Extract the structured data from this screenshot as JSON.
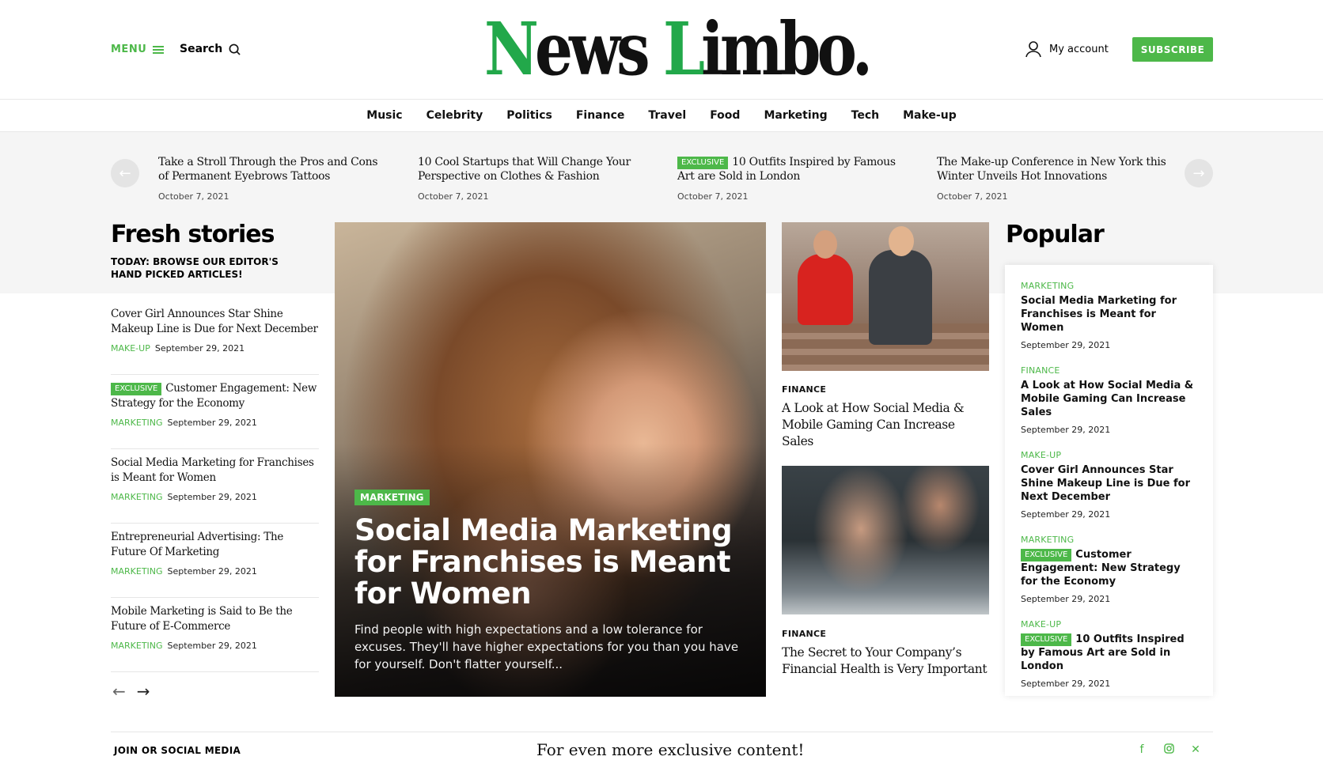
{
  "header": {
    "menu_label": "MENU",
    "search_label": "Search",
    "logo_part1": "News ",
    "logo_part2": "Limbo",
    "logo_part3": ".",
    "account_label": "My account",
    "subscribe_label": "SUBSCRIBE"
  },
  "nav": [
    "Music",
    "Celebrity",
    "Politics",
    "Finance",
    "Travel",
    "Food",
    "Marketing",
    "Tech",
    "Make-up"
  ],
  "ticker": [
    {
      "badge": "",
      "title": "Take a Stroll Through the Pros and Cons of Permanent Eyebrows Tattoos",
      "date": "October 7, 2021"
    },
    {
      "badge": "",
      "title": "10 Cool Startups that Will Change Your Perspective on Clothes & Fashion",
      "date": "October 7, 2021"
    },
    {
      "badge": "EXCLUSIVE",
      "title": "10 Outfits Inspired by Famous Art are Sold in London",
      "date": "October 7, 2021"
    },
    {
      "badge": "",
      "title": "The Make-up Conference in New York this Winter Unveils Hot Innovations",
      "date": "October 7, 2021"
    }
  ],
  "fresh": {
    "title": "Fresh stories",
    "subtitle": "TODAY: BROWSE OUR EDITOR'S HAND PICKED ARTICLES!",
    "items": [
      {
        "badge": "",
        "title": "Cover Girl Announces Star Shine Makeup Line is Due for Next December",
        "category": "MAKE-UP",
        "date": "September 29, 2021"
      },
      {
        "badge": "EXCLUSIVE",
        "title": "Customer Engagement: New Strategy for the Economy",
        "category": "MARKETING",
        "date": "September 29, 2021"
      },
      {
        "badge": "",
        "title": "Social Media Marketing for Franchises is Meant for Women",
        "category": "MARKETING",
        "date": "September 29, 2021"
      },
      {
        "badge": "",
        "title": "Entrepreneurial Advertising: The Future Of Marketing",
        "category": "MARKETING",
        "date": "September 29, 2021"
      },
      {
        "badge": "",
        "title": "Mobile Marketing is Said to Be the Future of E-Commerce",
        "category": "MARKETING",
        "date": "September 29, 2021"
      }
    ]
  },
  "hero": {
    "category": "MARKETING",
    "title": "Social Media Marketing for Franchises is Meant for Women",
    "excerpt": "Find people with high expectations and a low tolerance for excuses. They'll have higher expectations for you than you have for yourself. Don't flatter yourself..."
  },
  "middle": [
    {
      "category": "FINANCE",
      "title": "A Look at How Social Media & Mobile Gaming Can Increase Sales"
    },
    {
      "category": "FINANCE",
      "title": "The Secret to Your Company’s Financial Health is Very Important"
    }
  ],
  "popular": {
    "title": "Popular",
    "items": [
      {
        "category": "MARKETING",
        "badge": "",
        "title": "Social Media Marketing for Franchises is Meant for Women",
        "date": "September 29, 2021"
      },
      {
        "category": "FINANCE",
        "badge": "",
        "title": "A Look at How Social Media & Mobile Gaming Can Increase Sales",
        "date": "September 29, 2021"
      },
      {
        "category": "MAKE-UP",
        "badge": "",
        "title": "Cover Girl Announces Star Shine Makeup Line is Due for Next December",
        "date": "September 29, 2021"
      },
      {
        "category": "MARKETING",
        "badge": "EXCLUSIVE",
        "title": "Customer Engagement: New Strategy for the Economy",
        "date": "September 29, 2021"
      },
      {
        "category": "MAKE-UP",
        "badge": "EXCLUSIVE",
        "title": "10 Outfits Inspired by Famous Art are Sold in London",
        "date": "September 29, 2021"
      }
    ]
  },
  "footer": {
    "join_label": "JOIN OR SOCIAL MEDIA",
    "exclusive_text": "For even more exclusive content!",
    "socials": [
      "facebook-icon",
      "instagram-icon",
      "x-icon"
    ]
  },
  "colors": {
    "accent": "#4db849",
    "logo_green": "#22a84a"
  }
}
